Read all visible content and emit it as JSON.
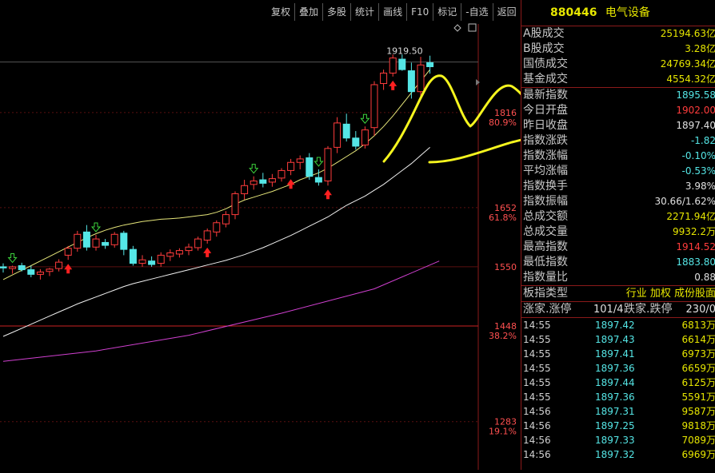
{
  "toolbar": [
    "复权",
    "叠加",
    "多股",
    "统计",
    "画线",
    "F10",
    "标记",
    "-自选",
    "返回"
  ],
  "header": {
    "code": "880446",
    "name": "电气设备"
  },
  "market_stats": [
    {
      "label": "A股成交",
      "value": "25194.63亿",
      "color": "#e6e600"
    },
    {
      "label": "B股成交",
      "value": "3.28亿",
      "color": "#e6e600"
    },
    {
      "label": "国债成交",
      "value": "24769.34亿",
      "color": "#e6e600"
    },
    {
      "label": "基金成交",
      "value": "4554.32亿",
      "color": "#e6e600"
    }
  ],
  "index_stats": [
    {
      "label": "最新指数",
      "value": "1895.58",
      "color": "#55e6e6"
    },
    {
      "label": "今日开盘",
      "value": "1902.00",
      "color": "#ff3c3c"
    },
    {
      "label": "昨日收盘",
      "value": "1897.40",
      "color": "#e0e0e0"
    },
    {
      "label": "指数涨跌",
      "value": "-1.82",
      "color": "#55e6e6"
    },
    {
      "label": "指数涨幅",
      "value": "-0.10%",
      "color": "#55e6e6"
    },
    {
      "label": "平均涨幅",
      "value": "-0.53%",
      "color": "#55e6e6"
    },
    {
      "label": "指数换手",
      "value": "3.98%",
      "color": "#e0e0e0"
    },
    {
      "label": "指数振幅",
      "value": "30.66/1.62%",
      "color": "#e0e0e0"
    },
    {
      "label": "总成交额",
      "value": "2271.94亿",
      "color": "#e6e600"
    },
    {
      "label": "总成交量",
      "value": "9932.2万",
      "color": "#e6e600"
    },
    {
      "label": "最高指数",
      "value": "1914.52",
      "color": "#ff3c3c"
    },
    {
      "label": "最低指数",
      "value": "1883.80",
      "color": "#55e6e6"
    },
    {
      "label": "指数量比",
      "value": "0.88",
      "color": "#e0e0e0"
    }
  ],
  "board_type": {
    "label": "板指类型",
    "value": "行业 加权 成份股面"
  },
  "breadth": {
    "up_label": "涨家.涨停",
    "up_value": "101/4",
    "down_label": "跌家.跌停",
    "down_value": "230/0"
  },
  "trades": [
    {
      "time": "14:55",
      "price": "1897.42",
      "vol": "6813万"
    },
    {
      "time": "14:55",
      "price": "1897.43",
      "vol": "6614万"
    },
    {
      "time": "14:55",
      "price": "1897.41",
      "vol": "6973万"
    },
    {
      "time": "14:55",
      "price": "1897.36",
      "vol": "6659万"
    },
    {
      "time": "14:55",
      "price": "1897.44",
      "vol": "6125万"
    },
    {
      "time": "14:55",
      "price": "1897.36",
      "vol": "5591万"
    },
    {
      "time": "14:56",
      "price": "1897.31",
      "vol": "9587万"
    },
    {
      "time": "14:56",
      "price": "1897.25",
      "vol": "9818万"
    },
    {
      "time": "14:56",
      "price": "1897.33",
      "vol": "7089万"
    },
    {
      "time": "14:56",
      "price": "1897.32",
      "vol": "6969万"
    }
  ],
  "chart_data": {
    "type": "candlestick",
    "y_ticks": [
      {
        "value": 1816,
        "pct": "80.9%"
      },
      {
        "value": 1652,
        "pct": "61.8%"
      },
      {
        "value": 1550,
        "pct": ""
      },
      {
        "value": 1448,
        "pct": "38.2%"
      },
      {
        "value": 1283,
        "pct": "19.1%"
      }
    ],
    "high_label": "1919.50",
    "candles": [
      {
        "o": 1550,
        "h": 1556,
        "l": 1540,
        "c": 1548
      },
      {
        "o": 1547,
        "h": 1552,
        "l": 1538,
        "c": 1550
      },
      {
        "o": 1552,
        "h": 1557,
        "l": 1542,
        "c": 1545
      },
      {
        "o": 1545,
        "h": 1552,
        "l": 1532,
        "c": 1537
      },
      {
        "o": 1537,
        "h": 1546,
        "l": 1528,
        "c": 1541
      },
      {
        "o": 1542,
        "h": 1548,
        "l": 1534,
        "c": 1546
      },
      {
        "o": 1547,
        "h": 1563,
        "l": 1542,
        "c": 1558
      },
      {
        "o": 1570,
        "h": 1586,
        "l": 1562,
        "c": 1582
      },
      {
        "o": 1582,
        "h": 1612,
        "l": 1576,
        "c": 1606
      },
      {
        "o": 1610,
        "h": 1622,
        "l": 1578,
        "c": 1584
      },
      {
        "o": 1584,
        "h": 1605,
        "l": 1578,
        "c": 1598
      },
      {
        "o": 1592,
        "h": 1598,
        "l": 1581,
        "c": 1587
      },
      {
        "o": 1588,
        "h": 1610,
        "l": 1583,
        "c": 1606
      },
      {
        "o": 1608,
        "h": 1612,
        "l": 1570,
        "c": 1580
      },
      {
        "o": 1580,
        "h": 1586,
        "l": 1552,
        "c": 1556
      },
      {
        "o": 1556,
        "h": 1570,
        "l": 1550,
        "c": 1562
      },
      {
        "o": 1560,
        "h": 1568,
        "l": 1550,
        "c": 1554
      },
      {
        "o": 1556,
        "h": 1575,
        "l": 1550,
        "c": 1570
      },
      {
        "o": 1568,
        "h": 1580,
        "l": 1560,
        "c": 1574
      },
      {
        "o": 1572,
        "h": 1582,
        "l": 1566,
        "c": 1578
      },
      {
        "o": 1578,
        "h": 1590,
        "l": 1570,
        "c": 1584
      },
      {
        "o": 1583,
        "h": 1602,
        "l": 1578,
        "c": 1598
      },
      {
        "o": 1596,
        "h": 1616,
        "l": 1590,
        "c": 1612
      },
      {
        "o": 1610,
        "h": 1630,
        "l": 1602,
        "c": 1626
      },
      {
        "o": 1624,
        "h": 1646,
        "l": 1618,
        "c": 1640
      },
      {
        "o": 1640,
        "h": 1680,
        "l": 1632,
        "c": 1676
      },
      {
        "o": 1676,
        "h": 1700,
        "l": 1666,
        "c": 1690
      },
      {
        "o": 1692,
        "h": 1706,
        "l": 1683,
        "c": 1698
      },
      {
        "o": 1700,
        "h": 1712,
        "l": 1687,
        "c": 1694
      },
      {
        "o": 1696,
        "h": 1710,
        "l": 1688,
        "c": 1702
      },
      {
        "o": 1703,
        "h": 1720,
        "l": 1697,
        "c": 1716
      },
      {
        "o": 1716,
        "h": 1736,
        "l": 1708,
        "c": 1730
      },
      {
        "o": 1730,
        "h": 1742,
        "l": 1718,
        "c": 1736
      },
      {
        "o": 1738,
        "h": 1746,
        "l": 1700,
        "c": 1706
      },
      {
        "o": 1704,
        "h": 1718,
        "l": 1690,
        "c": 1696
      },
      {
        "o": 1698,
        "h": 1758,
        "l": 1690,
        "c": 1754
      },
      {
        "o": 1756,
        "h": 1808,
        "l": 1746,
        "c": 1798
      },
      {
        "o": 1796,
        "h": 1814,
        "l": 1766,
        "c": 1772
      },
      {
        "o": 1772,
        "h": 1784,
        "l": 1752,
        "c": 1758
      },
      {
        "o": 1760,
        "h": 1792,
        "l": 1754,
        "c": 1786
      },
      {
        "o": 1790,
        "h": 1870,
        "l": 1776,
        "c": 1864
      },
      {
        "o": 1866,
        "h": 1890,
        "l": 1855,
        "c": 1884
      },
      {
        "o": 1884,
        "h": 1916,
        "l": 1878,
        "c": 1910
      },
      {
        "o": 1908,
        "h": 1916,
        "l": 1888,
        "c": 1890
      },
      {
        "o": 1888,
        "h": 1902,
        "l": 1840,
        "c": 1852
      },
      {
        "o": 1852,
        "h": 1912,
        "l": 1838,
        "c": 1898
      },
      {
        "o": 1902,
        "h": 1914,
        "l": 1883,
        "c": 1895
      }
    ],
    "ma_short": [
      1528,
      1536,
      1544,
      1552,
      1560,
      1568,
      1576,
      1584,
      1592,
      1600,
      1607,
      1613,
      1618,
      1622,
      1625,
      1628,
      1630,
      1632,
      1633,
      1634,
      1636,
      1638,
      1640,
      1644,
      1650,
      1658,
      1665,
      1670,
      1675,
      1680,
      1686,
      1692,
      1700,
      1706,
      1712,
      1720,
      1730,
      1740,
      1750,
      1762,
      1776,
      1792,
      1810,
      1830,
      1850,
      1870,
      1890
    ],
    "ma_mid": [
      1430,
      1437,
      1444,
      1451,
      1458,
      1465,
      1472,
      1479,
      1486,
      1492,
      1498,
      1504,
      1510,
      1516,
      1521,
      1525,
      1529,
      1533,
      1537,
      1541,
      1545,
      1549,
      1553,
      1557,
      1561,
      1566,
      1571,
      1577,
      1583,
      1590,
      1597,
      1604,
      1612,
      1620,
      1628,
      1636,
      1646,
      1656,
      1664,
      1672,
      1682,
      1692,
      1704,
      1716,
      1728,
      1742,
      1756
    ],
    "ma_long": {
      "x": [
        0,
        10,
        20,
        30,
        40,
        47
      ],
      "y": [
        1387,
        1405,
        1432,
        1470,
        1512,
        1560
      ]
    },
    "signals": [
      {
        "i": 1,
        "type": "up-hollow"
      },
      {
        "i": 10,
        "type": "up-hollow"
      },
      {
        "i": 7,
        "type": "down-solid"
      },
      {
        "i": 22,
        "type": "down-solid"
      },
      {
        "i": 27,
        "type": "up-hollow"
      },
      {
        "i": 31,
        "type": "down-solid"
      },
      {
        "i": 34,
        "type": "up-hollow"
      },
      {
        "i": 35,
        "type": "down-solid"
      },
      {
        "i": 39,
        "type": "up-hollow"
      },
      {
        "i": 42,
        "type": "down-solid"
      }
    ],
    "hlines": [
      1903,
      1816,
      1652,
      1550,
      1448,
      1283
    ],
    "ylim": [
      1200,
      2010
    ]
  }
}
